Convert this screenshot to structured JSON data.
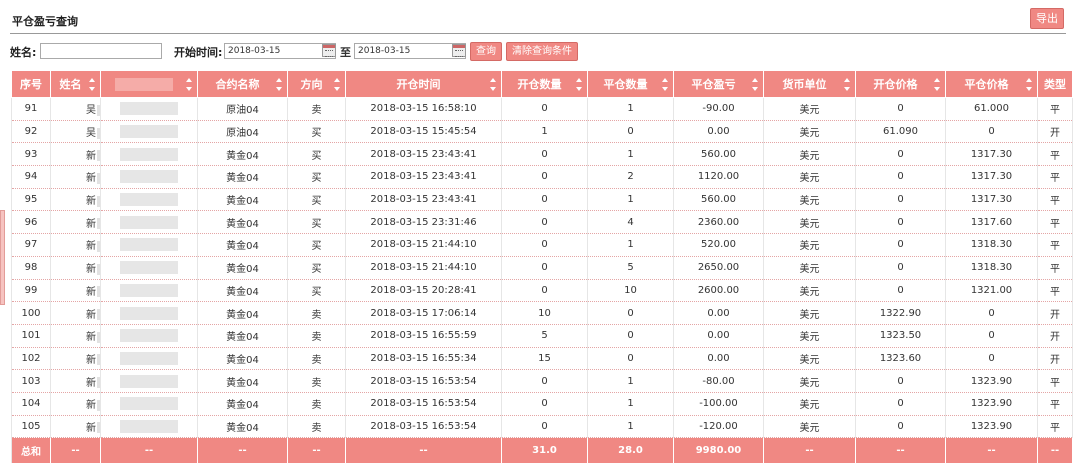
{
  "title": "平仓盈亏查询",
  "export_label": "导出",
  "filters": {
    "name_label": "姓名:",
    "name_value": "",
    "start_label": "开始时间:",
    "start_value": "2018-03-15",
    "to_label": "至",
    "end_value": "2018-03-15",
    "query_label": "查询",
    "clear_label": "清除查询条件"
  },
  "columns": [
    "序号",
    "姓名",
    "",
    "合约名称",
    "方向",
    "开仓时间",
    "开仓数量",
    "平仓数量",
    "平仓盈亏",
    "货币单位",
    "开仓价格",
    "平仓价格",
    "类型"
  ],
  "rows": [
    [
      "91",
      "吴",
      "",
      "原油04",
      "卖",
      "2018-03-15  16:58:10",
      "0",
      "1",
      "-90.00",
      "美元",
      "0",
      "61.000",
      "平"
    ],
    [
      "92",
      "吴",
      "",
      "原油04",
      "买",
      "2018-03-15  15:45:54",
      "1",
      "0",
      "0.00",
      "美元",
      "61.090",
      "0",
      "开"
    ],
    [
      "93",
      "新",
      "",
      "黄金04",
      "买",
      "2018-03-15  23:43:41",
      "0",
      "1",
      "560.00",
      "美元",
      "0",
      "1317.30",
      "平"
    ],
    [
      "94",
      "新",
      "",
      "黄金04",
      "买",
      "2018-03-15  23:43:41",
      "0",
      "2",
      "1120.00",
      "美元",
      "0",
      "1317.30",
      "平"
    ],
    [
      "95",
      "新",
      "",
      "黄金04",
      "买",
      "2018-03-15  23:43:41",
      "0",
      "1",
      "560.00",
      "美元",
      "0",
      "1317.30",
      "平"
    ],
    [
      "96",
      "新",
      "",
      "黄金04",
      "买",
      "2018-03-15  23:31:46",
      "0",
      "4",
      "2360.00",
      "美元",
      "0",
      "1317.60",
      "平"
    ],
    [
      "97",
      "新",
      "",
      "黄金04",
      "买",
      "2018-03-15  21:44:10",
      "0",
      "1",
      "520.00",
      "美元",
      "0",
      "1318.30",
      "平"
    ],
    [
      "98",
      "新",
      "",
      "黄金04",
      "买",
      "2018-03-15  21:44:10",
      "0",
      "5",
      "2650.00",
      "美元",
      "0",
      "1318.30",
      "平"
    ],
    [
      "99",
      "新",
      "",
      "黄金04",
      "买",
      "2018-03-15  20:28:41",
      "0",
      "10",
      "2600.00",
      "美元",
      "0",
      "1321.00",
      "平"
    ],
    [
      "100",
      "新",
      "",
      "黄金04",
      "卖",
      "2018-03-15  17:06:14",
      "10",
      "0",
      "0.00",
      "美元",
      "1322.90",
      "0",
      "开"
    ],
    [
      "101",
      "新",
      "",
      "黄金04",
      "卖",
      "2018-03-15  16:55:59",
      "5",
      "0",
      "0.00",
      "美元",
      "1323.50",
      "0",
      "开"
    ],
    [
      "102",
      "新",
      "",
      "黄金04",
      "卖",
      "2018-03-15  16:55:34",
      "15",
      "0",
      "0.00",
      "美元",
      "1323.60",
      "0",
      "开"
    ],
    [
      "103",
      "新",
      "",
      "黄金04",
      "卖",
      "2018-03-15  16:53:54",
      "0",
      "1",
      "-80.00",
      "美元",
      "0",
      "1323.90",
      "平"
    ],
    [
      "104",
      "新",
      "",
      "黄金04",
      "卖",
      "2018-03-15  16:53:54",
      "0",
      "1",
      "-100.00",
      "美元",
      "0",
      "1323.90",
      "平"
    ],
    [
      "105",
      "新",
      "",
      "黄金04",
      "卖",
      "2018-03-15  16:53:54",
      "0",
      "1",
      "-120.00",
      "美元",
      "0",
      "1323.90",
      "平"
    ]
  ],
  "footer": [
    "总和",
    "--",
    "--",
    "--",
    "--",
    "--",
    "31.0",
    "28.0",
    "9980.00",
    "--",
    "--",
    "--",
    "--"
  ],
  "colors": {
    "accent": "#f08883",
    "accent_border": "#d46a65"
  }
}
